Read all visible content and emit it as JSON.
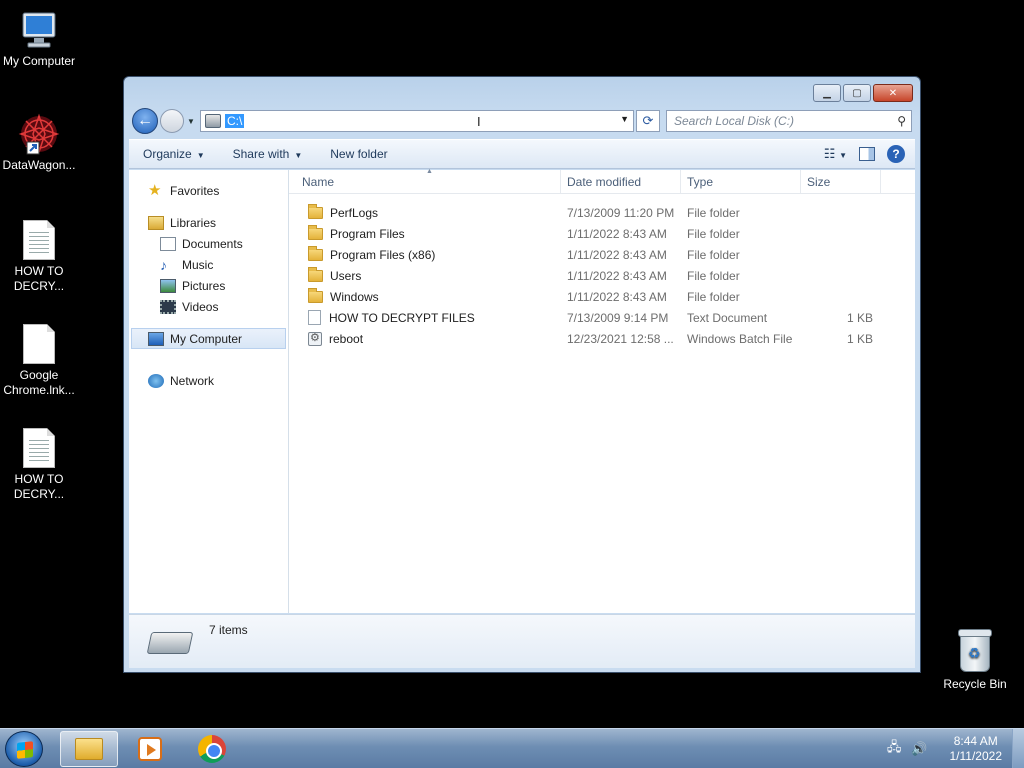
{
  "desktop": {
    "icons": [
      {
        "label": "My Computer"
      },
      {
        "label": "DataWagon..."
      },
      {
        "label": "HOW TO\nDECRY..."
      },
      {
        "label": "Google\nChrome.lnk..."
      },
      {
        "label": "HOW TO\nDECRY..."
      }
    ],
    "recycle_bin": "Recycle Bin"
  },
  "window": {
    "address_path": "C:\\",
    "search_placeholder": "Search Local Disk (C:)",
    "toolbar": {
      "organize": "Organize",
      "share_with": "Share with",
      "new_folder": "New folder"
    },
    "nav": {
      "favorites": "Favorites",
      "libraries": "Libraries",
      "documents": "Documents",
      "music": "Music",
      "pictures": "Pictures",
      "videos": "Videos",
      "my_computer": "My Computer",
      "network": "Network"
    },
    "columns": {
      "name": "Name",
      "date": "Date modified",
      "type": "Type",
      "size": "Size"
    },
    "files": [
      {
        "name": "PerfLogs",
        "date": "7/13/2009 11:20 PM",
        "type": "File folder",
        "size": "",
        "icon": "folder"
      },
      {
        "name": "Program Files",
        "date": "1/11/2022 8:43 AM",
        "type": "File folder",
        "size": "",
        "icon": "folder"
      },
      {
        "name": "Program Files (x86)",
        "date": "1/11/2022 8:43 AM",
        "type": "File folder",
        "size": "",
        "icon": "folder"
      },
      {
        "name": "Users",
        "date": "1/11/2022 8:43 AM",
        "type": "File folder",
        "size": "",
        "icon": "folder"
      },
      {
        "name": "Windows",
        "date": "1/11/2022 8:43 AM",
        "type": "File folder",
        "size": "",
        "icon": "folder"
      },
      {
        "name": "HOW TO DECRYPT FILES",
        "date": "7/13/2009 9:14 PM",
        "type": "Text Document",
        "size": "1 KB",
        "icon": "text"
      },
      {
        "name": "reboot",
        "date": "12/23/2021 12:58 ...",
        "type": "Windows Batch File",
        "size": "1 KB",
        "icon": "batch"
      }
    ],
    "details": {
      "items_count": "7 items"
    }
  },
  "taskbar": {
    "time": "8:44 AM",
    "date": "1/11/2022"
  }
}
